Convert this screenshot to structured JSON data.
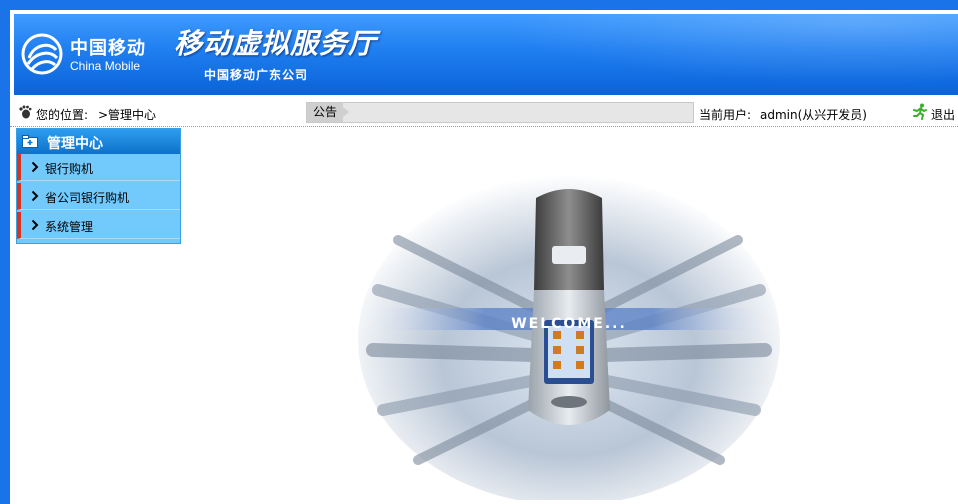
{
  "header": {
    "logo_cn": "中国移动",
    "logo_en": "China Mobile",
    "title": "移动虚拟服务厅",
    "subtitle": "中国移动广东公司"
  },
  "status": {
    "location_label": "您的位置:",
    "location_value": ">管理中心",
    "notice_tag": "公告",
    "notice_text": "",
    "user_label": "当前用户:",
    "user_value": "admin(从兴开发员)",
    "logout_label": "退出"
  },
  "sidebar": {
    "header": "管理中心",
    "items": [
      {
        "label": "银行购机"
      },
      {
        "label": "省公司银行购机"
      },
      {
        "label": "系统管理"
      }
    ]
  },
  "welcome": {
    "text": "WELCOME..."
  },
  "colors": {
    "page_border": "#1a73e8",
    "banner": "#1f7ef0",
    "sidebar_bg": "#72c9fb",
    "sidebar_accent": "#d9331c"
  }
}
